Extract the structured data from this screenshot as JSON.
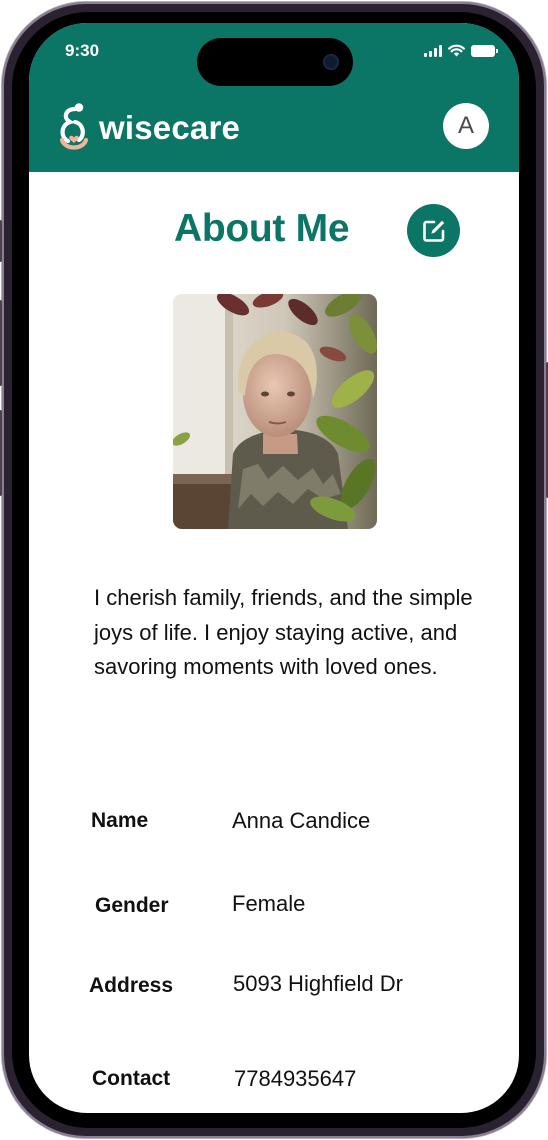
{
  "status_bar": {
    "time": "9:30"
  },
  "header": {
    "brand": "wisecare",
    "avatar_initial": "A"
  },
  "page": {
    "title": "About Me"
  },
  "bio": "I cherish family, friends, and the simple joys of life. I enjoy staying active, and savoring moments with loved ones.",
  "details": [
    {
      "label": "Name",
      "value": "Anna Candice"
    },
    {
      "label": "Gender",
      "value": "Female"
    },
    {
      "label": "Address",
      "value": "5093 Highfield Dr"
    },
    {
      "label": "Contact",
      "value": "7784935647"
    }
  ],
  "icons": {
    "logo": "wisecare-logo-icon",
    "edit": "edit-pencil-icon",
    "signal": "cellular-signal-icon",
    "wifi": "wifi-icon",
    "battery": "battery-icon"
  },
  "colors": {
    "brand": "#0b7566",
    "logo_accent": "#f2b49a",
    "header_text": "#ffffff"
  }
}
